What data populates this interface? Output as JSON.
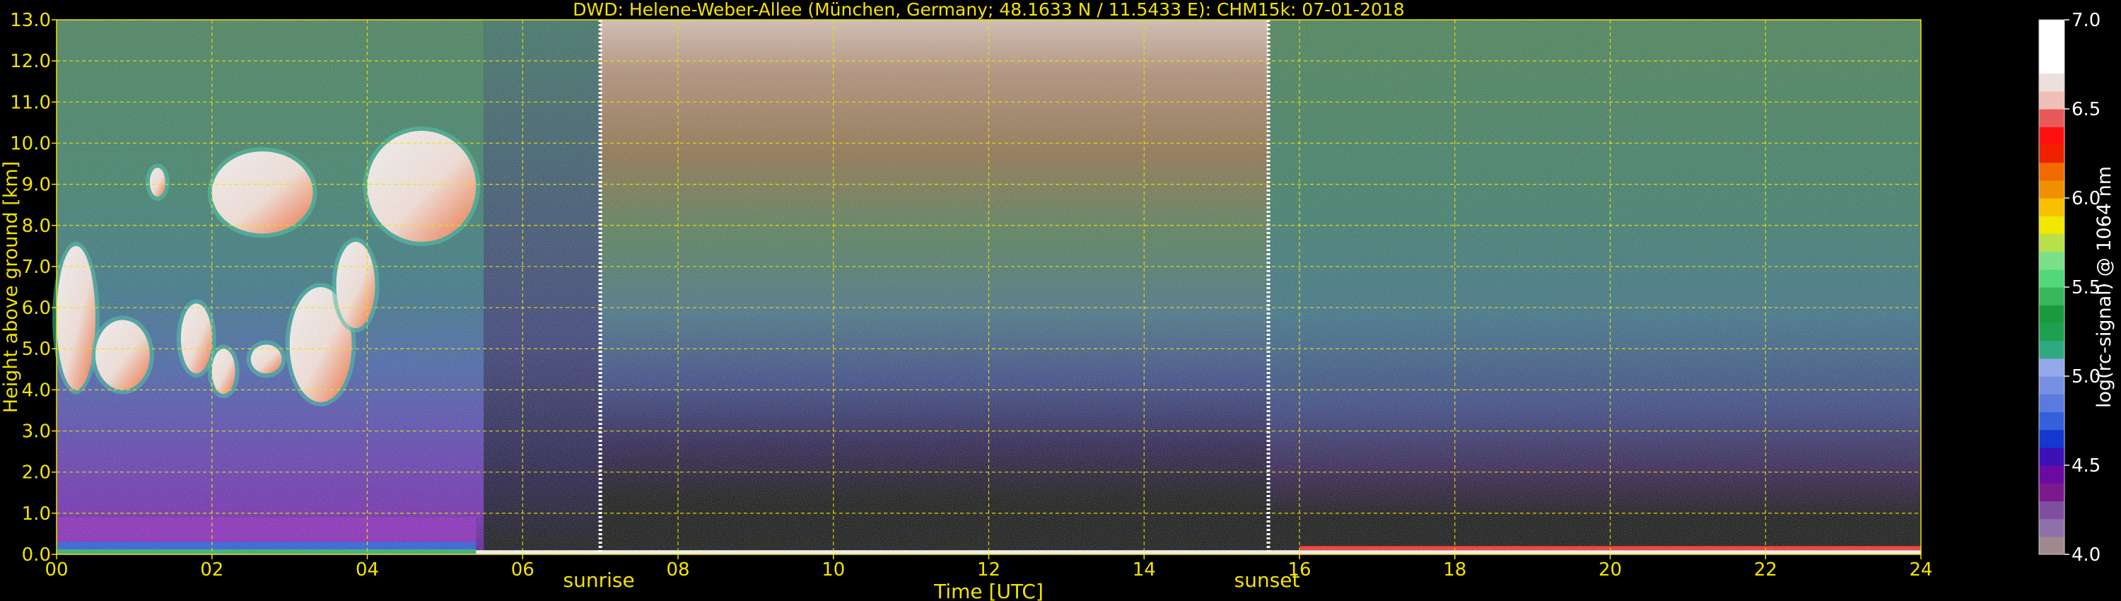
{
  "chart_data": {
    "type": "heatmap",
    "title": "DWD: Helene-Weber-Allee (München, Germany; 48.1633 N / 11.5433 E):    CHM15k: 07-01-2018",
    "xlabel": "Time [UTC]",
    "ylabel": "Height above ground [km]",
    "xlim": [
      0,
      24
    ],
    "ylim": [
      0,
      13
    ],
    "x_ticks": [
      "00",
      "02",
      "04",
      "06",
      "08",
      "10",
      "12",
      "14",
      "16",
      "18",
      "20",
      "22",
      "24"
    ],
    "y_ticks": [
      "0.0",
      "1.0",
      "2.0",
      "3.0",
      "4.0",
      "5.0",
      "6.0",
      "7.0",
      "8.0",
      "9.0",
      "10.0",
      "11.0",
      "12.0",
      "13.0"
    ],
    "grid": true,
    "annotations": [
      {
        "label": "sunrise",
        "x": 7.0
      },
      {
        "label": "sunset",
        "x": 15.6
      }
    ],
    "colorbar": {
      "label": "log(rc-signal) @ 1064 nm",
      "range": [
        4.0,
        7.0
      ],
      "ticks": [
        "4.0",
        "4.5",
        "5.0",
        "5.5",
        "6.0",
        "6.5",
        "7.0"
      ],
      "colors": [
        "#a08a8e",
        "#9070a8",
        "#7e4ea0",
        "#7a1a8c",
        "#6a0aa0",
        "#3e10b8",
        "#1438d0",
        "#3460dc",
        "#5a7ae0",
        "#7890e4",
        "#94a8ec",
        "#30a880",
        "#1fa050",
        "#1a9a3c",
        "#38b85a",
        "#52d878",
        "#7ae08a",
        "#b8e04a",
        "#f0e800",
        "#f8c000",
        "#f09000",
        "#f06a00",
        "#f02000",
        "#ff1010",
        "#e85a5a",
        "#f0c0b8",
        "#ece0dc",
        "#ffffff",
        "#ffffff",
        "#ffffff"
      ]
    },
    "cloud_layers": [
      {
        "t_start": 0.0,
        "t_end": 0.5,
        "h_bottom": 4.0,
        "h_top": 7.5
      },
      {
        "t_start": 0.5,
        "t_end": 1.2,
        "h_bottom": 4.0,
        "h_top": 5.7
      },
      {
        "t_start": 1.2,
        "t_end": 1.4,
        "h_bottom": 8.7,
        "h_top": 9.4
      },
      {
        "t_start": 1.6,
        "t_end": 2.0,
        "h_bottom": 4.4,
        "h_top": 6.1
      },
      {
        "t_start": 2.0,
        "t_end": 2.3,
        "h_bottom": 3.9,
        "h_top": 5.0
      },
      {
        "t_start": 2.0,
        "t_end": 3.3,
        "h_bottom": 7.8,
        "h_top": 9.8
      },
      {
        "t_start": 2.5,
        "t_end": 2.9,
        "h_bottom": 4.4,
        "h_top": 5.1
      },
      {
        "t_start": 3.0,
        "t_end": 3.8,
        "h_bottom": 3.7,
        "h_top": 6.5
      },
      {
        "t_start": 3.6,
        "t_end": 4.1,
        "h_bottom": 5.5,
        "h_top": 7.6
      },
      {
        "t_start": 4.0,
        "t_end": 5.4,
        "h_bottom": 7.6,
        "h_top": 10.3
      }
    ],
    "boundary_layer": {
      "t_start": 0.0,
      "t_end": 5.4,
      "h_top": 0.9
    }
  }
}
